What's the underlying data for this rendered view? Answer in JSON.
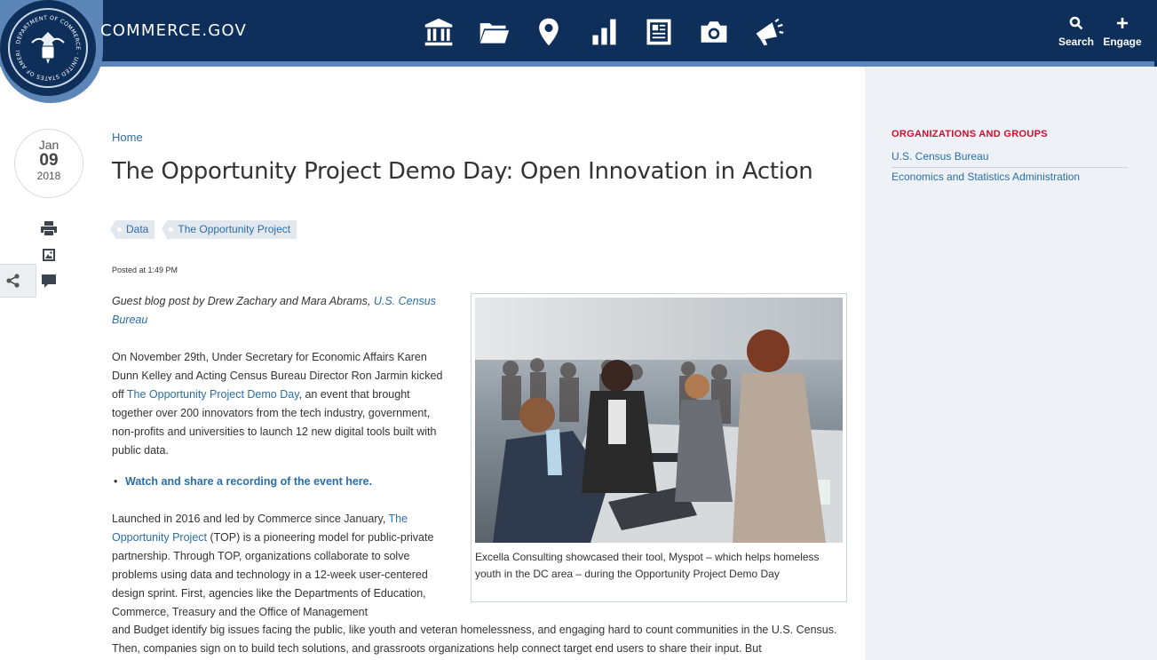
{
  "header": {
    "site_name": "COMMERCE.GOV",
    "nav_icons": [
      "bank-icon",
      "folder-icon",
      "map-pin-icon",
      "bar-chart-icon",
      "newspaper-icon",
      "camera-icon",
      "megaphone-icon"
    ],
    "search_label": "Search",
    "engage_label": "Engage",
    "colors": {
      "navy": "#0d2f5a",
      "stripe": "#5b86b7"
    }
  },
  "seal": {
    "text": "DEPARTMENT OF COMMERCE · UNITED STATES OF AMERICA"
  },
  "date": {
    "month": "Jan",
    "day": "09",
    "year": "2018"
  },
  "tools": [
    "print-icon",
    "image-icon",
    "comment-icon",
    "share-icon"
  ],
  "breadcrumb": {
    "home": "Home"
  },
  "article": {
    "title": "The Opportunity Project Demo Day: Open Innovation in Action",
    "tags": [
      "Data",
      "The Opportunity Project"
    ],
    "posted": "Posted at 1:49 PM",
    "guest_prefix": "Guest blog post by Drew Zachary and Mara Abrams, ",
    "guest_link": "U.S. Census Bureau",
    "p1_before": "On November 29th, Under Secretary for Economic Affairs Karen Dunn Kelley and Acting Census Bureau Director Ron Jarmin kicked off ",
    "p1_link": "The Opportunity Project Demo Day",
    "p1_after": ", an event that brought together over 200 innovators from the tech industry, government, non-profits and universities to launch 12 new digital tools built with public data.",
    "watch_link": "Watch and share a recording of the event here.",
    "p2_before": "Launched in 2016 and led by Commerce since January, ",
    "p2_link": "The Opportunity Project",
    "p2_after_narrow": " (TOP) is a pioneering model for public-private partnership. Through TOP, organizations collaborate to solve problems using data and technology in a 12-week user-centered design sprint. First, agencies like the Departments of Education, Commerce, Treasury and the Office of Management",
    "p2_wide": "and Budget identify big issues facing the public, like youth and veteran homelessness, and engaging hard to count communities in the U.S. Census. Then, companies sign on to build tech solutions, and grassroots organizations help connect target end users to share their input. But",
    "figure_caption": "Excella Consulting showcased their tool, Myspot – which helps homeless youth in the DC area – during the Opportunity Project Demo Day"
  },
  "sidebar": {
    "heading": "ORGANIZATIONS AND GROUPS",
    "items": [
      "U.S. Census Bureau",
      "Economics and Statistics Administration"
    ]
  }
}
